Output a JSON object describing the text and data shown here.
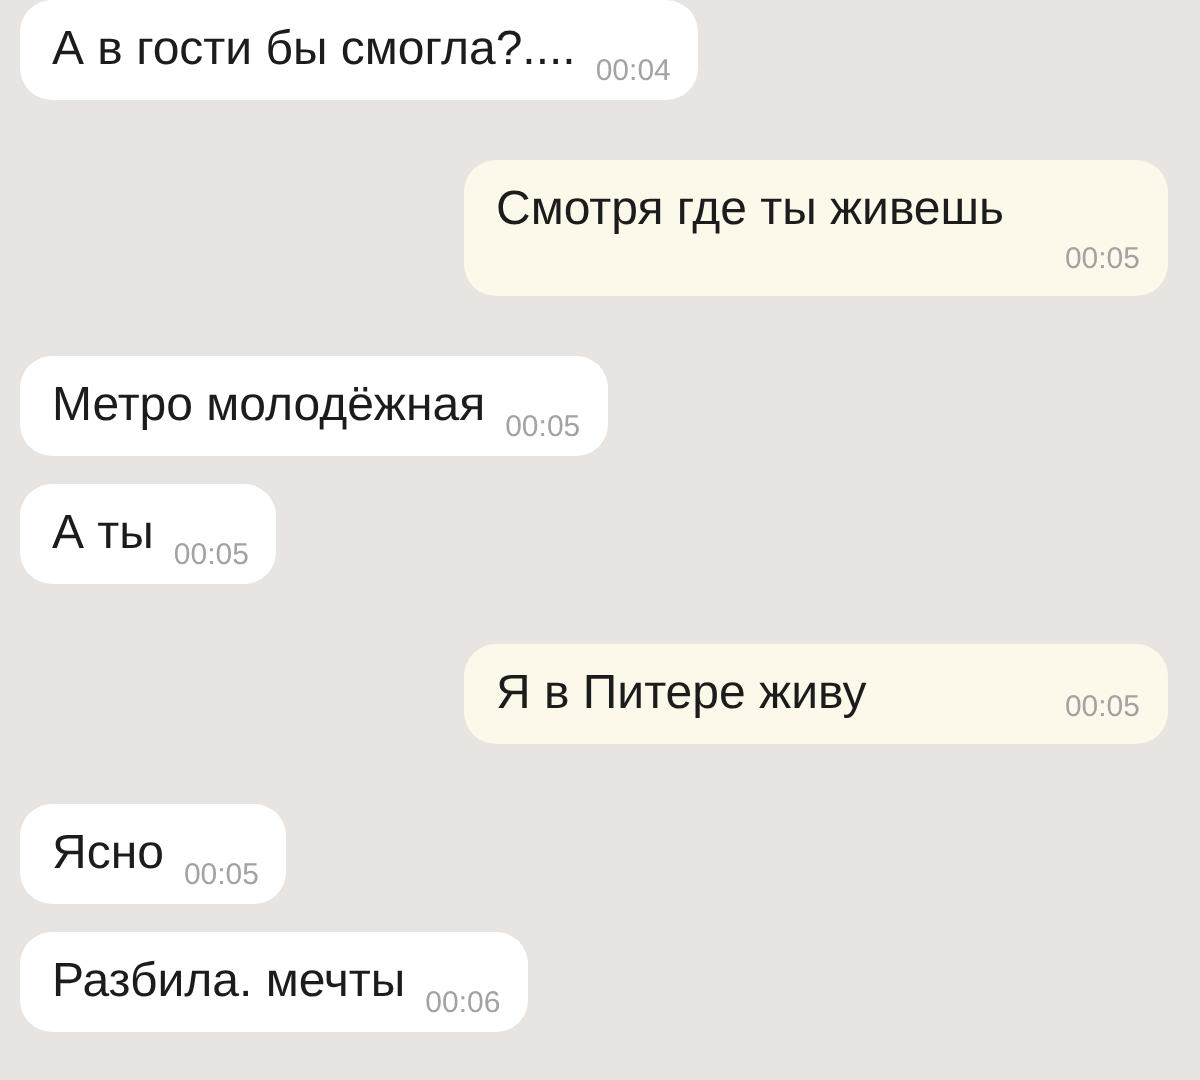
{
  "messages": [
    {
      "kind": "incoming",
      "text": "А в гости бы смогла?....",
      "time": "00:04"
    },
    {
      "kind": "outgoing",
      "text": "Смотря где ты живешь",
      "time": "00:05"
    },
    {
      "kind": "incoming",
      "text": "Метро молодёжная",
      "time": "00:05"
    },
    {
      "kind": "incoming",
      "text": "А ты",
      "time": "00:05"
    },
    {
      "kind": "outgoing",
      "text": "Я в Питере живу",
      "time": "00:05"
    },
    {
      "kind": "incoming",
      "text": "Ясно",
      "time": "00:05"
    },
    {
      "kind": "incoming",
      "text": "Разбила. мечты",
      "time": "00:06"
    }
  ]
}
